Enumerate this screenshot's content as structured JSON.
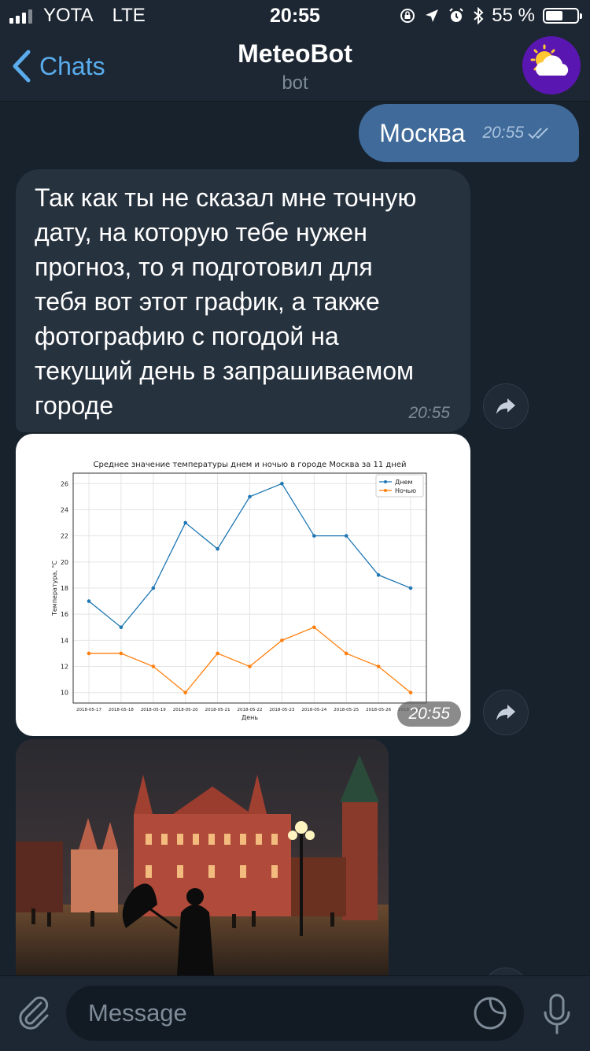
{
  "status_bar": {
    "carrier": "YOTA",
    "network": "LTE",
    "time": "20:55",
    "battery": "55 %",
    "battery_level": 0.55
  },
  "header": {
    "back_label": "Chats",
    "title": "MeteoBot",
    "subtitle": "bot"
  },
  "messages": {
    "outgoing": {
      "text": "Москва",
      "time": "20:55"
    },
    "incoming": {
      "lines": [
        "Так как ты не сказал мне точную",
        "дату, на которую тебе нужен",
        "прогноз, то я подготовил для",
        "тебя вот этот график, а также",
        "фотографию с погодой на",
        "текущий день в запрашиваемом",
        "городе"
      ],
      "time": "20:55"
    },
    "chart_time": "20:55"
  },
  "chart_data": {
    "type": "line",
    "title": "Среднее значение температуры днем и ночью в городе Москва за 11 дней",
    "xlabel": "День",
    "ylabel": "Температура, °C",
    "categories": [
      "2018-05-17",
      "2018-05-18",
      "2018-05-19",
      "2018-05-20",
      "2018-05-21",
      "2018-05-22",
      "2018-05-23",
      "2018-05-24",
      "2018-05-25",
      "2018-05-26",
      "2018-05-27"
    ],
    "series": [
      {
        "name": "Днем",
        "color": "#1f77b4",
        "values": [
          17,
          15,
          18,
          23,
          21,
          25,
          26,
          22,
          22,
          19,
          18
        ]
      },
      {
        "name": "Ночью",
        "color": "#ff7f0e",
        "values": [
          13,
          13,
          12,
          10,
          13,
          12,
          14,
          15,
          13,
          12,
          10
        ]
      }
    ],
    "yticks": [
      10,
      12,
      14,
      16,
      18,
      20,
      22,
      24,
      26
    ],
    "ylim": [
      9.2,
      26.8
    ],
    "grid": true,
    "legend": "top-right"
  },
  "input": {
    "placeholder": "Message"
  },
  "colors": {
    "accent": "#5aacec",
    "outgoing_bubble": "#3f6a99",
    "incoming_bubble": "#27323f",
    "background": "#18222d"
  }
}
